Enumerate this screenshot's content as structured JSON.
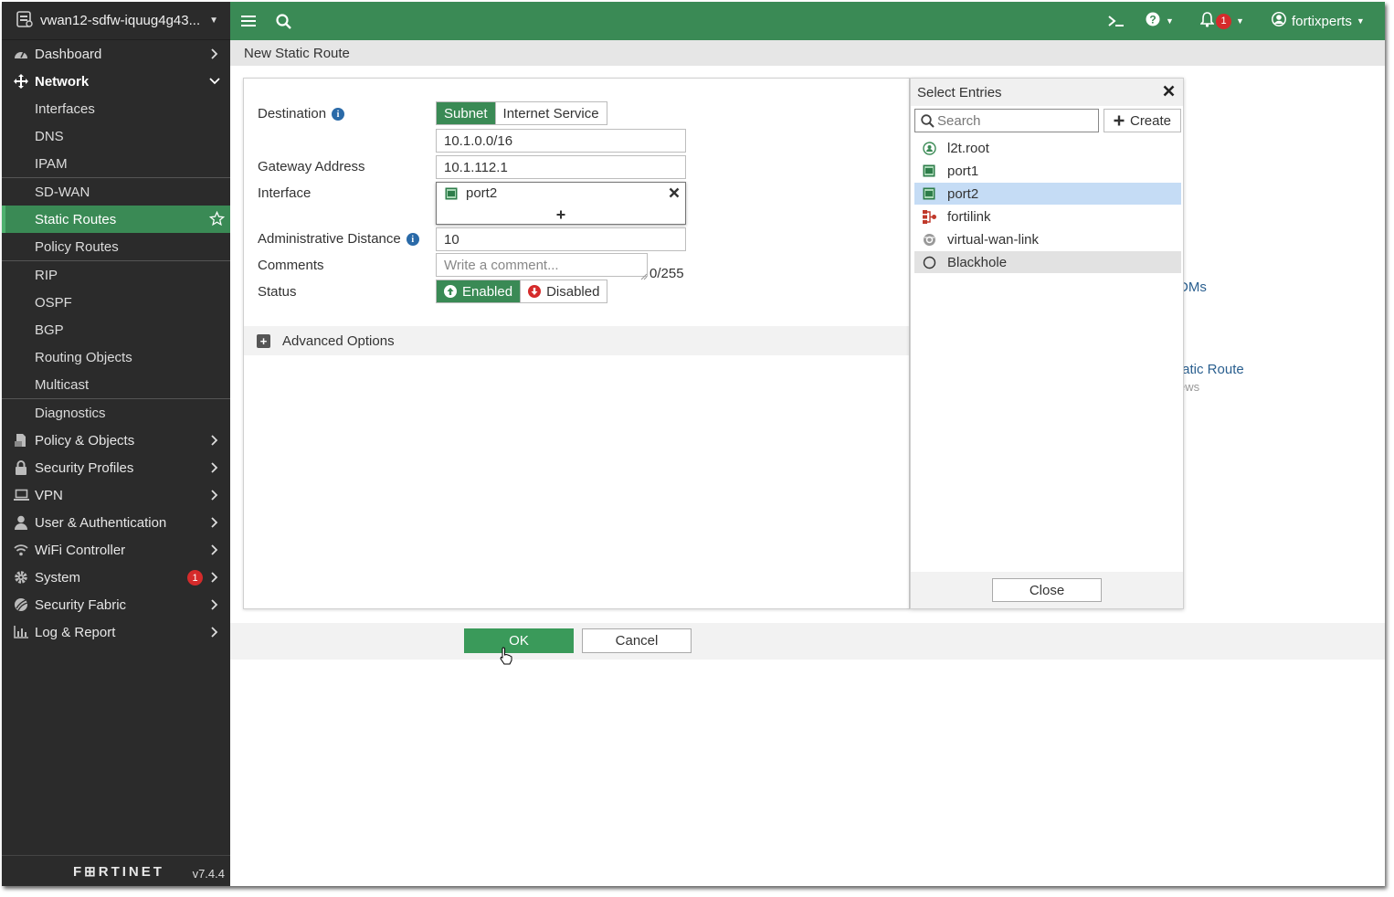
{
  "sidebar": {
    "host": "vwan12-sdfw-iquug4g43...",
    "items": [
      {
        "label": "Dashboard"
      },
      {
        "label": "Network"
      },
      {
        "label": "Interfaces"
      },
      {
        "label": "DNS"
      },
      {
        "label": "IPAM"
      },
      {
        "label": "SD-WAN"
      },
      {
        "label": "Static Routes"
      },
      {
        "label": "Policy Routes"
      },
      {
        "label": "RIP"
      },
      {
        "label": "OSPF"
      },
      {
        "label": "BGP"
      },
      {
        "label": "Routing Objects"
      },
      {
        "label": "Multicast"
      },
      {
        "label": "Diagnostics"
      },
      {
        "label": "Policy & Objects"
      },
      {
        "label": "Security Profiles"
      },
      {
        "label": "VPN"
      },
      {
        "label": "User & Authentication"
      },
      {
        "label": "WiFi Controller"
      },
      {
        "label": "System",
        "badge": "1"
      },
      {
        "label": "Security Fabric"
      },
      {
        "label": "Log & Report"
      }
    ],
    "logo": "F⊞RTINET",
    "version": "v7.4.4"
  },
  "topbar": {
    "notif_count": "1",
    "user": "fortixperts",
    "accent": "#3a8a55"
  },
  "page": {
    "title": "New Static Route",
    "bg_link_1": "DMs",
    "bg_sub_1": "s",
    "bg_sub_2": "s",
    "bg_link_2": "tatic Route",
    "bg_sub_3": "ews"
  },
  "form": {
    "destination_label": "Destination",
    "dest_opt_subnet": "Subnet",
    "dest_opt_internet": "Internet Service",
    "destination_value": "10.1.0.0/16",
    "gateway_label": "Gateway Address",
    "gateway_value": "10.1.112.1",
    "interface_label": "Interface",
    "interface_value": "port2",
    "admin_distance_label": "Administrative Distance",
    "admin_distance_value": "10",
    "comments_label": "Comments",
    "comments_placeholder": "Write a comment...",
    "comments_count": "0/255",
    "status_label": "Status",
    "status_enabled": "Enabled",
    "status_disabled": "Disabled",
    "advanced_label": "Advanced Options"
  },
  "entries": {
    "title": "Select Entries",
    "search_placeholder": "Search",
    "create_label": "Create",
    "items": [
      {
        "label": "l2t.root",
        "icon": "tunnel-icon"
      },
      {
        "label": "port1",
        "icon": "port-icon"
      },
      {
        "label": "port2",
        "icon": "port-icon"
      },
      {
        "label": "fortilink",
        "icon": "fortilink-icon"
      },
      {
        "label": "virtual-wan-link",
        "icon": "sdwan-icon"
      },
      {
        "label": "Blackhole",
        "icon": "blackhole-icon"
      }
    ],
    "close_label": "Close"
  },
  "actions": {
    "ok_label": "OK",
    "cancel_label": "Cancel"
  }
}
